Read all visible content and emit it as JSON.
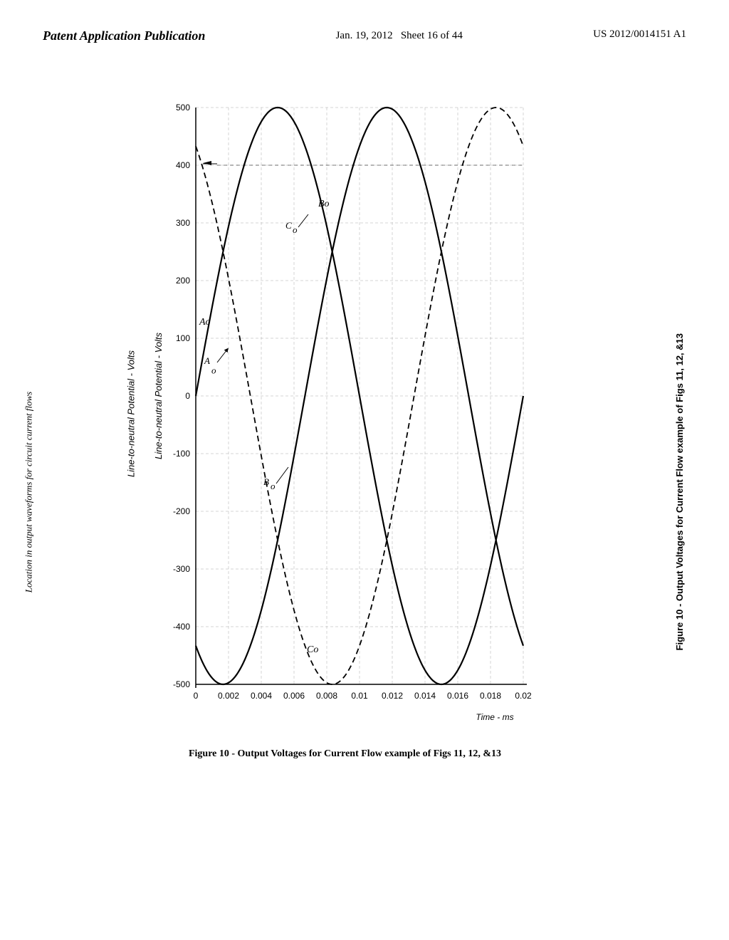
{
  "header": {
    "title_left": "Patent Application Publication",
    "date": "Jan. 19, 2012",
    "sheet": "Sheet 16 of 44",
    "patent_number": "US 2012/0014151 A1"
  },
  "chart": {
    "y_axis_label": "Line-to-neutral Potential - Volts",
    "x_axis_label": "Time - ms",
    "location_label": "Location in output waveforms for circuit current flows",
    "y_ticks": [
      "500",
      "400",
      "300",
      "200",
      "100",
      "0",
      "-100",
      "-200",
      "-300",
      "-400",
      "-500"
    ],
    "x_ticks": [
      "0.002",
      "0.004",
      "0.006",
      "0.008",
      "0.01",
      "0.012",
      "0.014",
      "0.016",
      "0.018",
      "0.02"
    ],
    "curves": [
      "A_o",
      "B_o",
      "C_o"
    ],
    "figure_caption": "Figure 10 - Output Voltages for Current Flow example of Figs 11, 12, &13"
  }
}
